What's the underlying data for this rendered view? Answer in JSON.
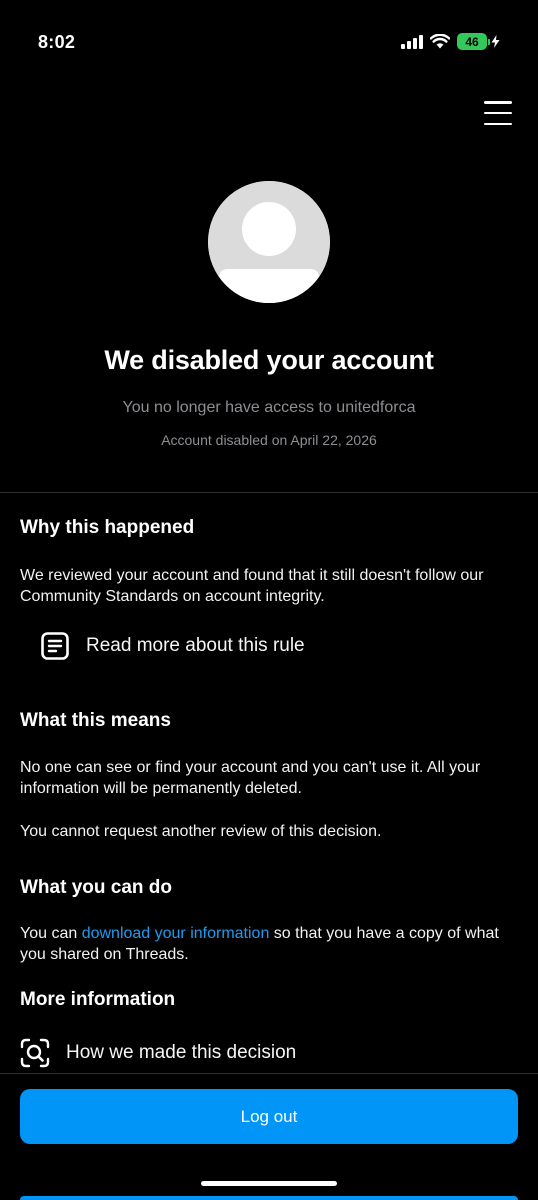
{
  "status_bar": {
    "time": "8:02",
    "battery_level": "46",
    "icons": [
      "cellular-signal-icon",
      "wifi-icon",
      "battery-charging-icon"
    ]
  },
  "header": {
    "menu_icon": "hamburger-menu-icon"
  },
  "profile": {
    "avatar_icon": "default-avatar-icon",
    "title": "We disabled your account",
    "subtitle": "You no longer have access to unitedforca",
    "disabled_date": "Account disabled on April 22, 2026"
  },
  "why": {
    "heading": "Why this happened",
    "text": "We reviewed your account and found that it still doesn't follow our Community Standards on account integrity.",
    "rule_link": {
      "icon": "document-icon",
      "label": "Read more about this rule"
    }
  },
  "means": {
    "heading": "What this means",
    "text1": "No one can see or find your account and you can't use it. All your information will be permanently deleted.",
    "text2": "You cannot request another review of this decision."
  },
  "can_do": {
    "heading": "What you can do",
    "text_before": "You can ",
    "link": "download your information",
    "text_after": " so that you have a copy of what you shared on Threads."
  },
  "more_info": {
    "heading": "More information",
    "decision_link": {
      "icon": "search-scan-icon",
      "label": "How we made this decision"
    }
  },
  "footer": {
    "logout_label": "Log out"
  },
  "colors": {
    "background": "#000000",
    "accent_blue": "#0095f6",
    "link_blue": "#1d9bf0",
    "muted_text": "#8e8e93",
    "battery_green": "#34c759"
  }
}
